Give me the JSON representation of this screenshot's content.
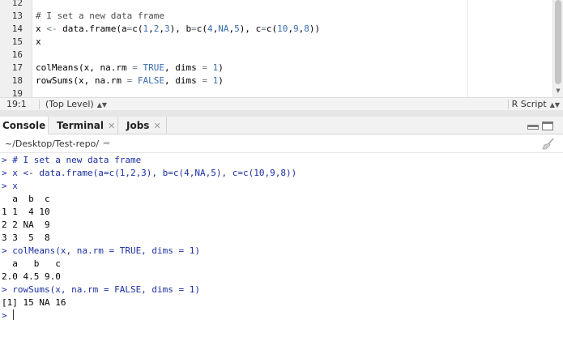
{
  "editor": {
    "lines": [
      {
        "num": "12",
        "tokens": []
      },
      {
        "num": "13",
        "tokens": [
          {
            "t": "# I set a new data frame",
            "c": "c-comment"
          }
        ]
      },
      {
        "num": "14",
        "tokens": [
          {
            "t": "x ",
            "c": ""
          },
          {
            "t": "<-",
            "c": "c-op"
          },
          {
            "t": " data.frame(a",
            "c": ""
          },
          {
            "t": "=",
            "c": "c-op"
          },
          {
            "t": "c(",
            "c": ""
          },
          {
            "t": "1",
            "c": "c-num"
          },
          {
            "t": ",",
            "c": ""
          },
          {
            "t": "2",
            "c": "c-num"
          },
          {
            "t": ",",
            "c": ""
          },
          {
            "t": "3",
            "c": "c-num"
          },
          {
            "t": "), b",
            "c": ""
          },
          {
            "t": "=",
            "c": "c-op"
          },
          {
            "t": "c(",
            "c": ""
          },
          {
            "t": "4",
            "c": "c-num"
          },
          {
            "t": ",",
            "c": ""
          },
          {
            "t": "NA",
            "c": "c-kw"
          },
          {
            "t": ",",
            "c": ""
          },
          {
            "t": "5",
            "c": "c-num"
          },
          {
            "t": "), c",
            "c": ""
          },
          {
            "t": "=",
            "c": "c-op"
          },
          {
            "t": "c(",
            "c": ""
          },
          {
            "t": "10",
            "c": "c-num"
          },
          {
            "t": ",",
            "c": ""
          },
          {
            "t": "9",
            "c": "c-num"
          },
          {
            "t": ",",
            "c": ""
          },
          {
            "t": "8",
            "c": "c-num"
          },
          {
            "t": "))",
            "c": ""
          }
        ]
      },
      {
        "num": "15",
        "tokens": [
          {
            "t": "x",
            "c": ""
          }
        ]
      },
      {
        "num": "16",
        "tokens": []
      },
      {
        "num": "17",
        "tokens": [
          {
            "t": "colMeans(x, na.rm ",
            "c": ""
          },
          {
            "t": "=",
            "c": "c-op"
          },
          {
            "t": " ",
            "c": ""
          },
          {
            "t": "TRUE",
            "c": "c-kw"
          },
          {
            "t": ", dims ",
            "c": ""
          },
          {
            "t": "=",
            "c": "c-op"
          },
          {
            "t": " ",
            "c": ""
          },
          {
            "t": "1",
            "c": "c-num"
          },
          {
            "t": ")",
            "c": ""
          }
        ]
      },
      {
        "num": "18",
        "tokens": [
          {
            "t": "rowSums(x, na.rm ",
            "c": ""
          },
          {
            "t": "=",
            "c": "c-op"
          },
          {
            "t": " ",
            "c": ""
          },
          {
            "t": "FALSE",
            "c": "c-kw"
          },
          {
            "t": ", dims ",
            "c": ""
          },
          {
            "t": "=",
            "c": "c-op"
          },
          {
            "t": " ",
            "c": ""
          },
          {
            "t": "1",
            "c": "c-num"
          },
          {
            "t": ")",
            "c": ""
          }
        ]
      },
      {
        "num": "19",
        "tokens": []
      }
    ]
  },
  "status": {
    "position": "19:1",
    "scope": "(Top Level)",
    "filetype": "R Script"
  },
  "console_pane": {
    "tabs": [
      {
        "label": "Console",
        "closable": false
      },
      {
        "label": "Terminal",
        "closable": true
      },
      {
        "label": "Jobs",
        "closable": true
      }
    ],
    "working_dir": "~/Desktop/Test-repo/"
  },
  "console": {
    "lines": [
      {
        "kind": "in",
        "text": "> # I set a new data frame"
      },
      {
        "kind": "in",
        "text": "> x <- data.frame(a=c(1,2,3), b=c(4,NA,5), c=c(10,9,8))"
      },
      {
        "kind": "in",
        "text": "> x"
      },
      {
        "kind": "out",
        "text": "  a  b  c"
      },
      {
        "kind": "out",
        "text": "1 1  4 10"
      },
      {
        "kind": "out",
        "text": "2 2 NA  9"
      },
      {
        "kind": "out",
        "text": "3 3  5  8"
      },
      {
        "kind": "in",
        "text": "> colMeans(x, na.rm = TRUE, dims = 1)"
      },
      {
        "kind": "out",
        "text": "  a   b   c "
      },
      {
        "kind": "out",
        "text": "2.0 4.5 9.0 "
      },
      {
        "kind": "in",
        "text": "> rowSums(x, na.rm = FALSE, dims = 1)"
      },
      {
        "kind": "out",
        "text": "[1] 15 NA 16"
      }
    ],
    "prompt": "> "
  }
}
